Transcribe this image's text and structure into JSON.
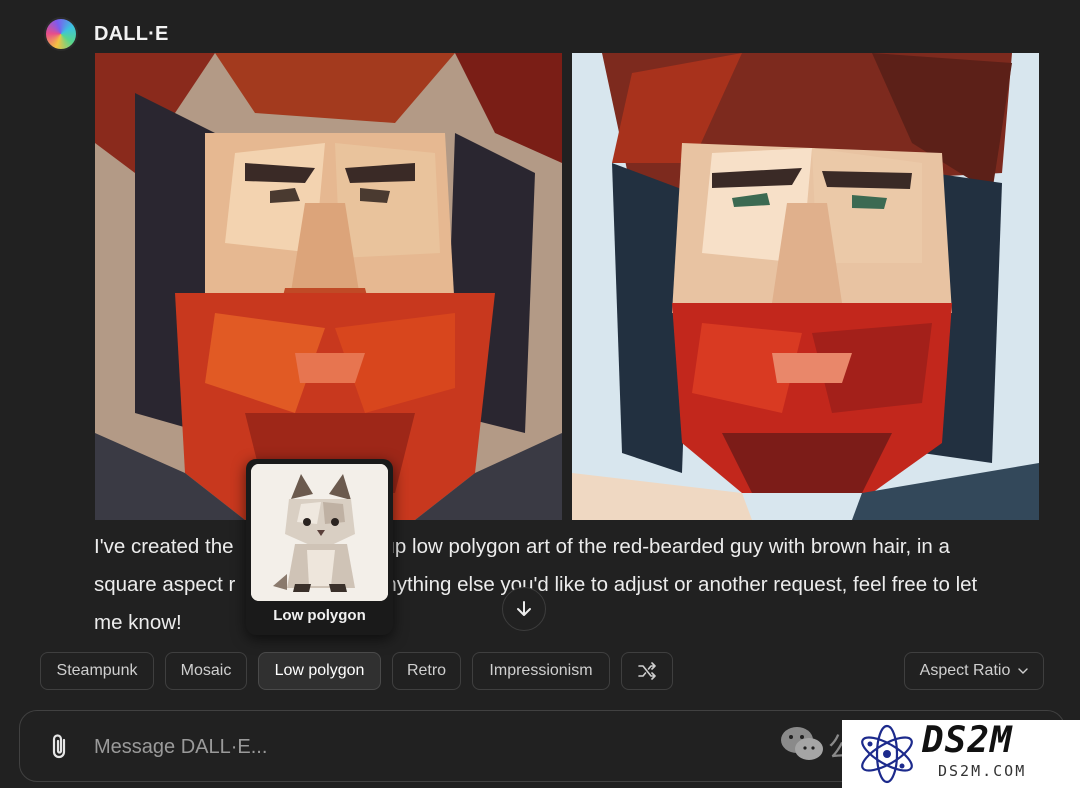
{
  "header": {
    "app_name": "DALL·E"
  },
  "images": [
    {
      "name": "generated-image-1"
    },
    {
      "name": "generated-image-2"
    }
  ],
  "response": {
    "line1_start": "I've created the",
    "line1_end": "up low polygon art of the red-bearded guy with brown hair, in a",
    "line2_start": "square aspect r",
    "line2_end": "nything else you'd like to adjust or another request, feel free to let",
    "line3": "me know!"
  },
  "tooltip": {
    "label": "Low polygon"
  },
  "style_chips": [
    {
      "label": "Steampunk",
      "active": false
    },
    {
      "label": "Mosaic",
      "active": false
    },
    {
      "label": "Low polygon",
      "active": true
    },
    {
      "label": "Retro",
      "active": false
    },
    {
      "label": "Impressionism",
      "active": false
    }
  ],
  "shuffle_icon": "shuffle-icon",
  "aspect_ratio": {
    "label": "Aspect Ratio"
  },
  "composer": {
    "placeholder": "Message DALL·E..."
  },
  "watermark": {
    "title": "DS2M",
    "subtitle": "DS2M.COM",
    "wechat_char": "公"
  },
  "colors": {
    "background": "#212121",
    "chip_border": "#3f3f3f",
    "text": "#ececec"
  }
}
